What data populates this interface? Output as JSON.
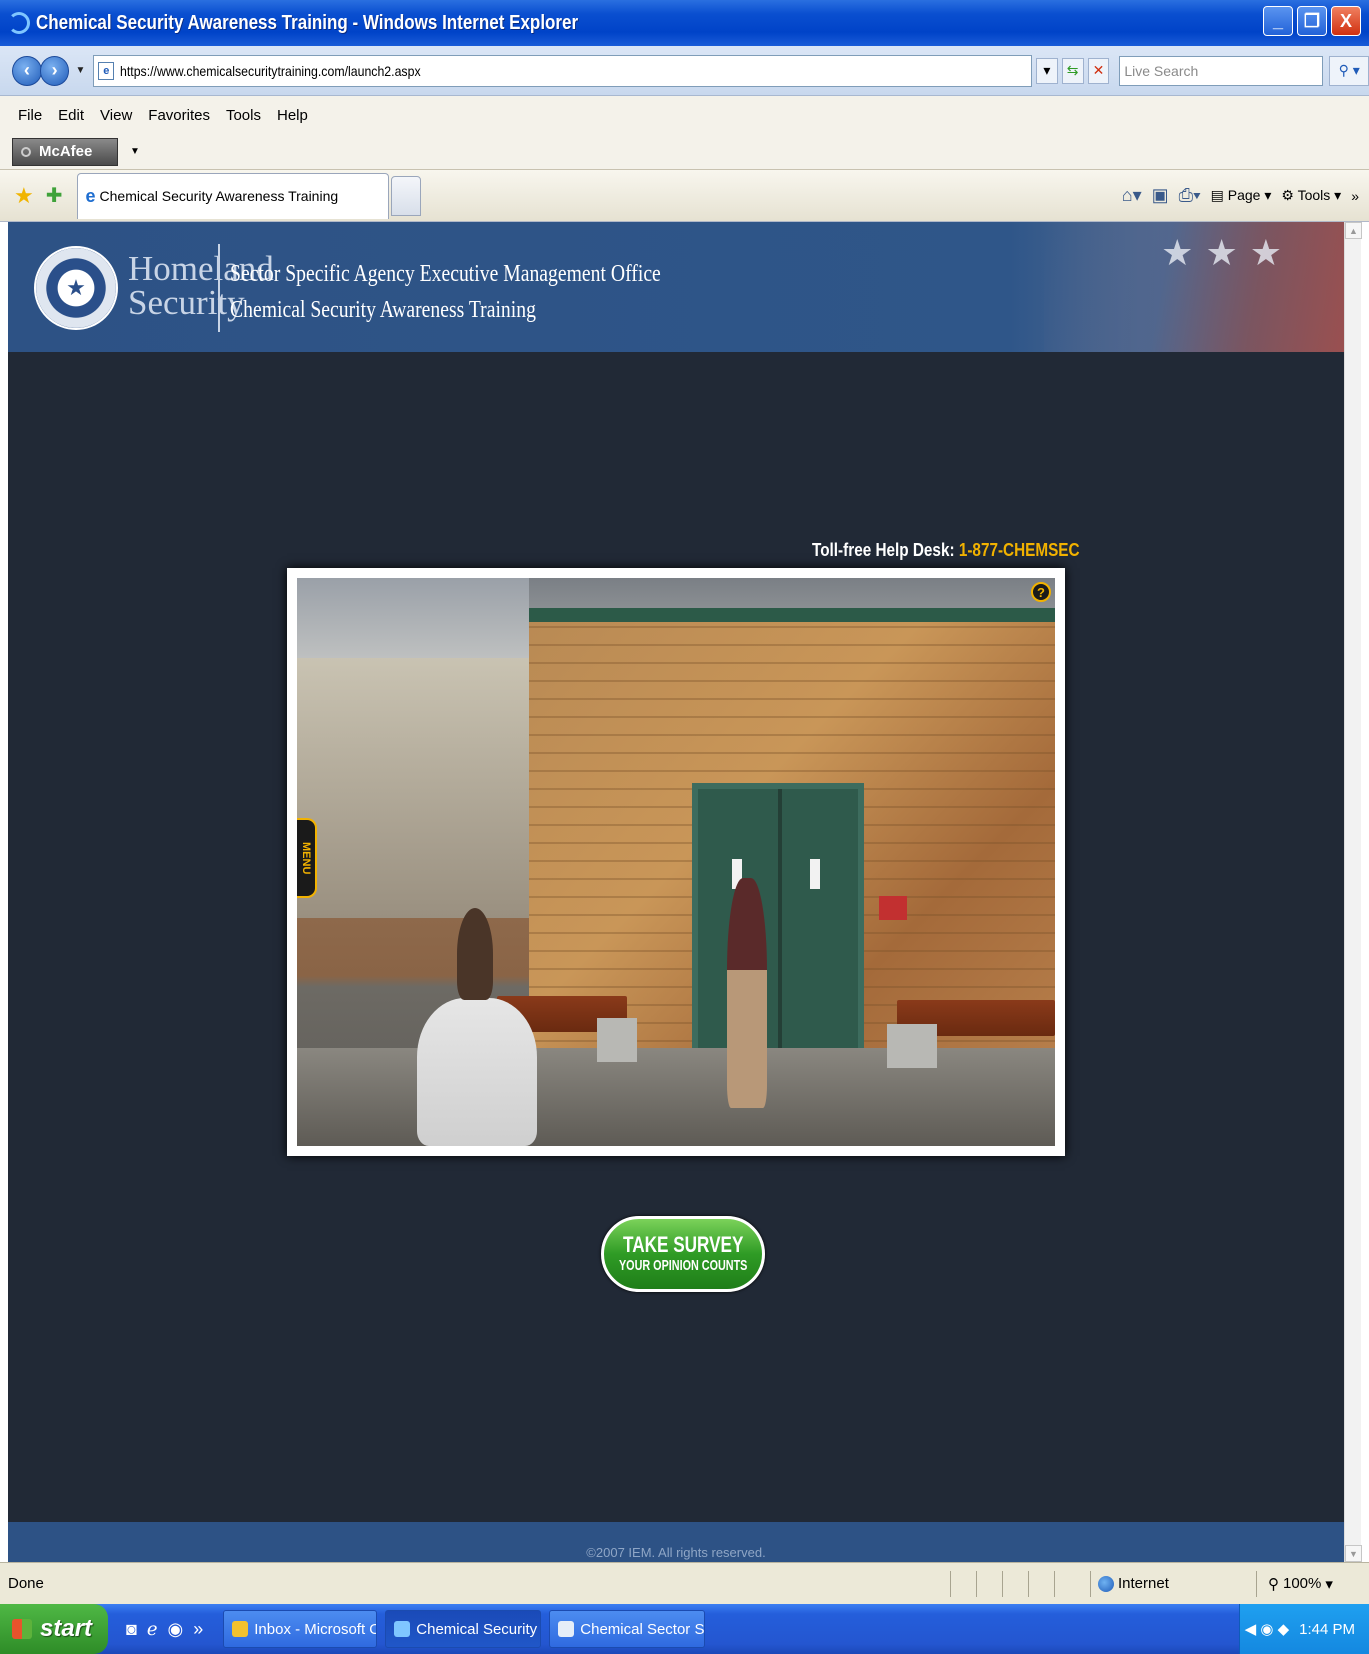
{
  "window": {
    "title": "Chemical Security Awareness Training - Windows Internet Explorer",
    "minimize": "_",
    "restore": "❐",
    "close": "X"
  },
  "addressbar": {
    "url": "https://www.chemicalsecuritytraining.com/launch2.aspx",
    "search_placeholder": "Live Search"
  },
  "menu": [
    "File",
    "Edit",
    "View",
    "Favorites",
    "Tools",
    "Help"
  ],
  "toolbar": {
    "mcafee_label": "McAfee"
  },
  "tabs": [
    {
      "label": "Chemical Security Awareness Training"
    }
  ],
  "command_bar": {
    "page_label": "Page",
    "tools_label": "Tools"
  },
  "site": {
    "agency_line1": "Homeland",
    "agency_line2": "Security",
    "office_line1": "Sector Specific Agency Executive Management Office",
    "office_line2": "Chemical Security Awareness Training",
    "helpdesk_label": "Toll-free Help Desk:",
    "helpdesk_number": "1-877-CHEMSEC",
    "menu_tab": "MENU",
    "help_icon": "?",
    "survey_line1": "TAKE SURVEY",
    "survey_line2": "YOUR OPINION COUNTS",
    "footer": "©2007 IEM. All rights reserved."
  },
  "status": {
    "text": "Done",
    "zone": "Internet",
    "zoom": "100%"
  },
  "taskbar": {
    "start": "start",
    "tasks": [
      {
        "label": "Inbox - Microsoft Out..."
      },
      {
        "label": "Chemical Security Aw..."
      },
      {
        "label": "Chemical Sector Secu..."
      }
    ],
    "clock": "1:44 PM"
  },
  "icons": [
    "ie-icon",
    "back-icon",
    "forward-icon",
    "refresh-icon",
    "stop-icon",
    "search-icon",
    "favorites-star-icon",
    "add-favorites-icon",
    "home-icon",
    "feeds-icon",
    "print-icon",
    "page-icon",
    "tools-gear-icon",
    "dhs-seal-icon",
    "globe-icon",
    "windows-flag-icon"
  ],
  "colors": {
    "page_bg": "#212936",
    "header_bg": "#2d5285",
    "accent": "#f2b200",
    "survey_green": "#2f9b25"
  }
}
